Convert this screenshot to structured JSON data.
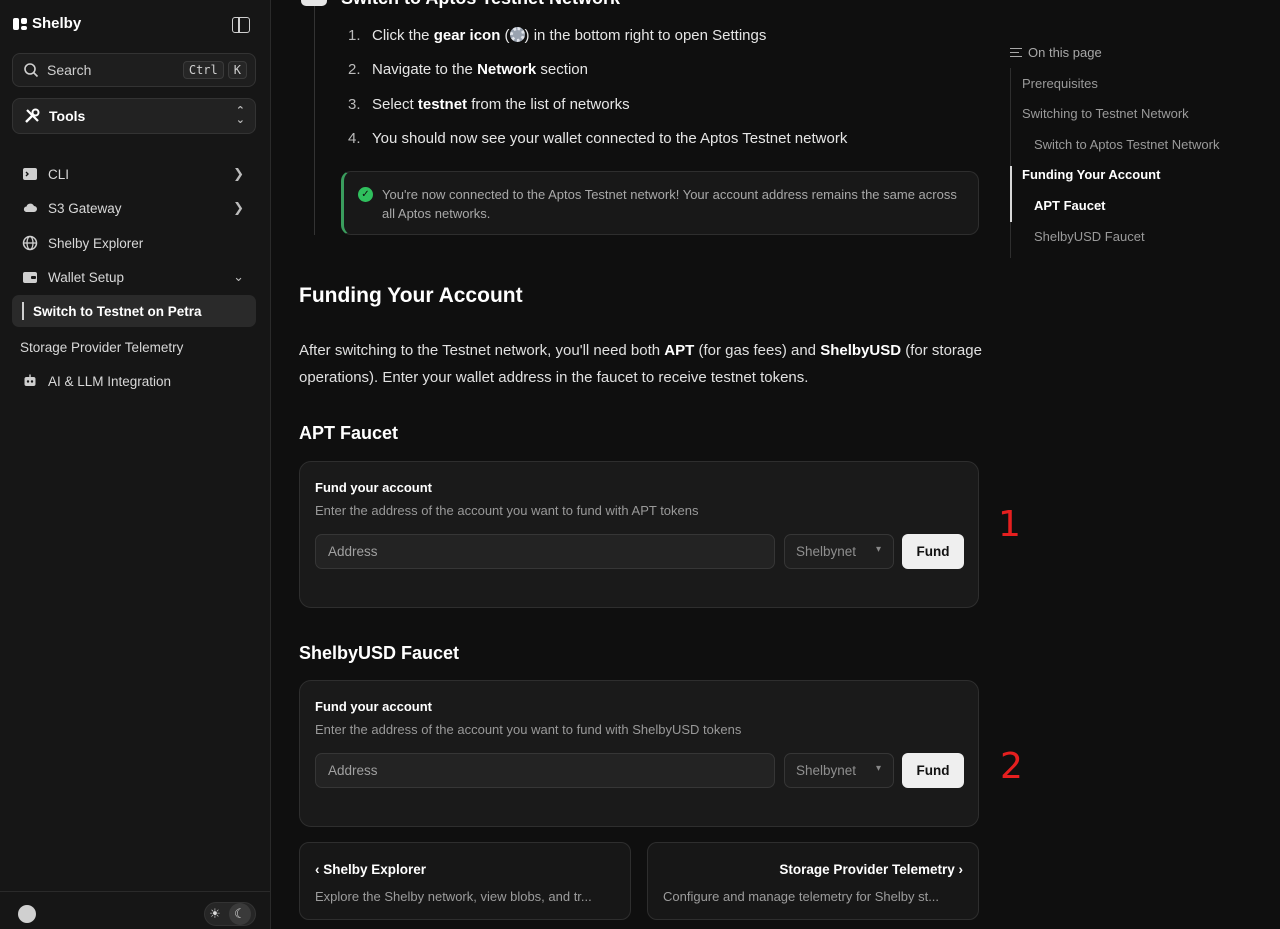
{
  "sidebar": {
    "brand": "Shelby",
    "search_label": "Search",
    "shortcut": [
      "Ctrl",
      "K"
    ],
    "tools_label": "Tools",
    "items": [
      {
        "label": "CLI",
        "icon": "terminal-icon"
      },
      {
        "label": "S3 Gateway",
        "icon": "cloud-icon"
      },
      {
        "label": "Shelby Explorer",
        "icon": "globe-icon"
      },
      {
        "label": "Wallet Setup",
        "icon": "wallet-icon"
      },
      {
        "label": "Switch to Testnet on Petra"
      },
      {
        "label": "Storage Provider Telemetry"
      },
      {
        "label": "AI & LLM Integration",
        "icon": "robot-icon"
      }
    ]
  },
  "main": {
    "top_heading": "Switch to Aptos Testnet Network",
    "steps": [
      {
        "num": "1.",
        "pre": "Click the ",
        "bold": "gear icon",
        "post": " in the bottom right to open Settings"
      },
      {
        "num": "2.",
        "pre": "Navigate to the ",
        "bold": "Network",
        "post": " section"
      },
      {
        "num": "3.",
        "pre": "Select ",
        "bold": "testnet",
        "post": " from the list of networks"
      },
      {
        "num": "4.",
        "pre": "You should now see your wallet connected to the Aptos Testnet network",
        "bold": "",
        "post": ""
      }
    ],
    "callout": "You're now connected to the Aptos Testnet network! Your account address remains the same across all Aptos networks.",
    "funding_title": "Funding Your Account",
    "funding_para": {
      "p1": "After switching to the Testnet network, you'll need both ",
      "b1": "APT",
      "p2": " (for gas fees) and ",
      "b2": "ShelbyUSD",
      "p3": " (for storage operations). Enter your wallet address in the faucet to receive testnet tokens."
    },
    "apt_faucet": {
      "title": "APT Faucet",
      "card_title": "Fund your account",
      "card_desc": "Enter the address of the account you want to fund with APT tokens",
      "placeholder": "Address",
      "network": "Shelbynet",
      "button": "Fund",
      "marker": "1"
    },
    "usd_faucet": {
      "title": "ShelbyUSD Faucet",
      "card_title": "Fund your account",
      "card_desc": "Enter the address of the account you want to fund with ShelbyUSD tokens",
      "placeholder": "Address",
      "network": "Shelbynet",
      "button": "Fund",
      "marker": "2"
    },
    "prev": {
      "title": "Shelby Explorer",
      "desc": "Explore the Shelby network, view blobs, and tr..."
    },
    "next": {
      "title": "Storage Provider Telemetry",
      "desc": "Configure and manage telemetry for Shelby st..."
    }
  },
  "toc": {
    "heading": "On this page",
    "items": [
      "Prerequisites",
      "Switching to Testnet Network",
      "Switch to Aptos Testnet Network",
      "Funding Your Account",
      "APT Faucet",
      "ShelbyUSD Faucet"
    ]
  },
  "colors": {
    "accent_green": "#2fbf5d",
    "marker_red": "#e51f1f"
  }
}
